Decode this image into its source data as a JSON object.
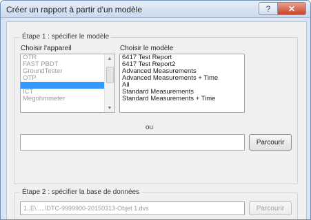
{
  "window": {
    "title": "Créer un rapport à partir d'un modèle",
    "help_label": "?",
    "close_label": "✕"
  },
  "step1": {
    "title": "Étape 1 : spécifier le modèle",
    "device_label": "Choisir l'appareil",
    "model_label": "Choisir le modèle",
    "devices": [
      {
        "label": "OTR",
        "state": "dim"
      },
      {
        "label": "FAST PBDT",
        "state": "dim"
      },
      {
        "label": "GroundTester",
        "state": "dim"
      },
      {
        "label": "OTP",
        "state": "dim"
      },
      {
        "label": "",
        "state": "selected"
      },
      {
        "label": "ICT",
        "state": "dim"
      },
      {
        "label": "Megohmmeter",
        "state": "dim"
      },
      {
        "label": "",
        "state": "dim"
      }
    ],
    "models": [
      "6417 Test Report",
      "6417 Test Report2",
      "Advanced Measurements",
      "Advanced Measurements + Time",
      "All",
      "Standard Measurements",
      "Standard Measurements + Time"
    ],
    "or_label": "ou",
    "path_value": "",
    "browse_label": "Parcourir"
  },
  "step2": {
    "title": "Étape 2 : spécifier la base de données",
    "path_value": "1..E\\.....\\DTC-9999900-20150313-Objet 1.dvs",
    "browse_label": "Parcourir"
  }
}
